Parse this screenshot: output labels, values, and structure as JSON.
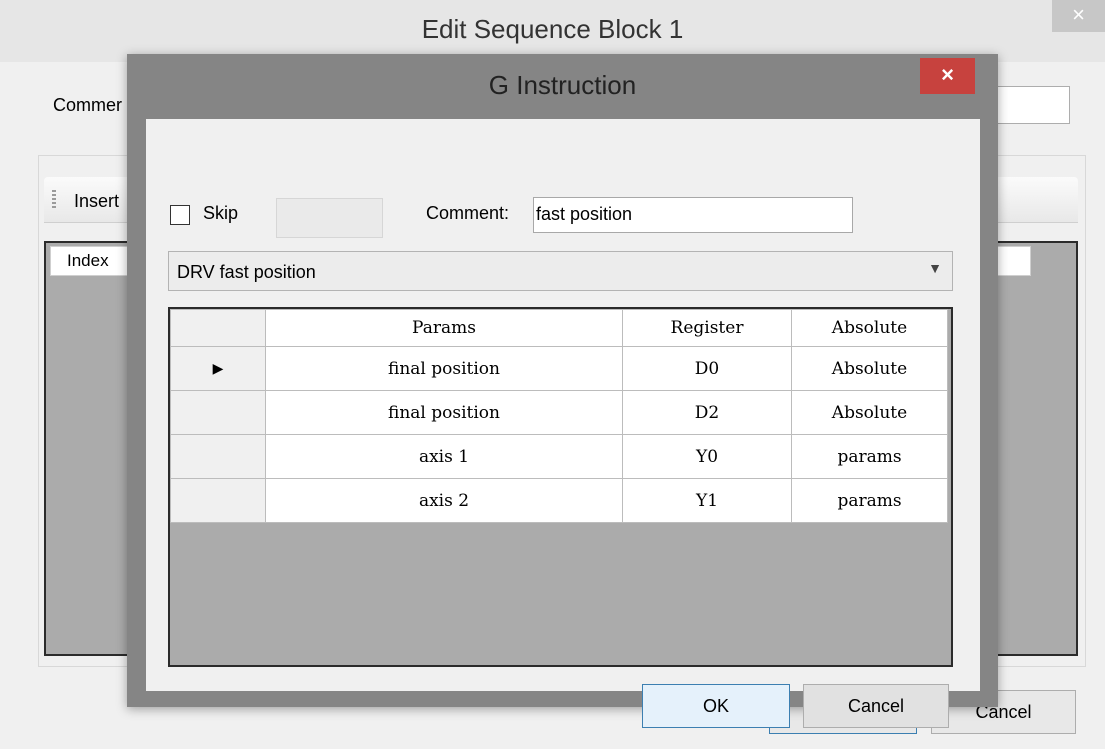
{
  "background_window": {
    "title": "Edit Sequence Block 1",
    "close_glyph": "×",
    "comment_label": "Commer",
    "toolbar_label": "Insert",
    "grid_header_index": "Index",
    "ok_label": "OK",
    "cancel_label": "Cancel"
  },
  "dialog": {
    "title": "G Instruction",
    "close_glyph": "×",
    "skip_label": "Skip",
    "skip_checked": false,
    "comment_label": "Comment:",
    "comment_value": "fast position",
    "instruction_selected": "DRV fast position",
    "grid": {
      "columns": [
        "Params",
        "Register",
        "Absolute"
      ],
      "current_row_glyph": "▶",
      "rows": [
        {
          "params": "final position",
          "register": "D0",
          "absolute": "Absolute"
        },
        {
          "params": "final position",
          "register": "D2",
          "absolute": "Absolute"
        },
        {
          "params": "axis 1",
          "register": "Y0",
          "absolute": "params"
        },
        {
          "params": "axis 2",
          "register": "Y1",
          "absolute": "params"
        }
      ]
    },
    "ok_label": "OK",
    "cancel_label": "Cancel"
  },
  "colors": {
    "close_button_red": "#c7423e",
    "dialog_frame": "#858585",
    "grid_background": "#ababab",
    "default_button_border": "#3c7fb1"
  }
}
